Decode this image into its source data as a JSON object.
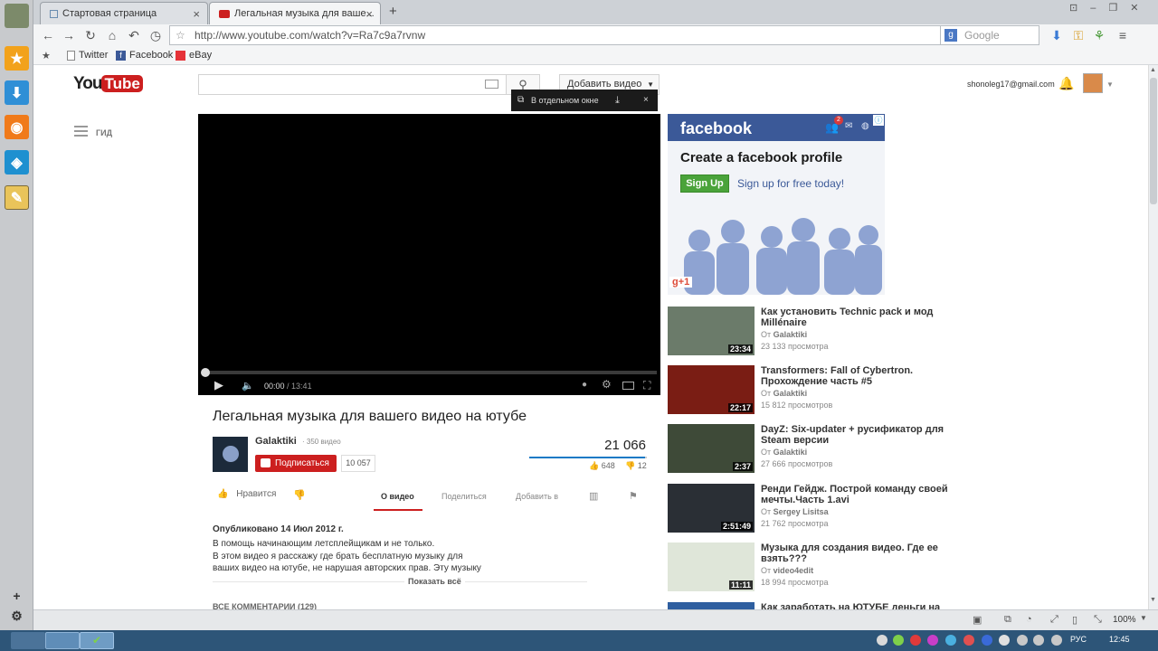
{
  "browser": {
    "tabs": [
      {
        "label": "Стартовая страница"
      },
      {
        "label": "Легальная музыка для ваше..."
      }
    ],
    "url": "http://www.youtube.com/watch?v=Ra7c9a7rvnw",
    "search_placeholder": "Google",
    "bookmarks": [
      "Twitter",
      "Facebook",
      "eBay"
    ],
    "zoom": "100%",
    "lang": "РУС",
    "clock": "12:45"
  },
  "youtube": {
    "logo": "YouTube",
    "upload_label": "Добавить видео",
    "popout_label": "В отдельном окне",
    "account": "shonoleg17@gmail.com",
    "guide_label": "ГИД",
    "player": {
      "time_current": "00:00",
      "time_total": "13:41",
      "progress": 0
    },
    "video": {
      "title": "Легальная музыка для вашего видео на ютубе",
      "channel": "Galaktiki",
      "channel_videos": "· 350 видео",
      "subscribe_label": "Подписаться",
      "subscribers": "10 057",
      "views": "21 066",
      "likes": "648",
      "dislikes": "12",
      "like_label": "Нравится"
    },
    "tabs": [
      "О видео",
      "Поделиться",
      "Добавить в"
    ],
    "description": {
      "published": "Опубликовано 14 Июл 2012 г.",
      "lines": [
        "В помощь начинающим летсплейщикам и не только.",
        "В этом видео я расскажу где брать бесплатную музыку для",
        "ваших видео на ютубе, не нарушая авторских прав. Эту музыку"
      ],
      "show_all": "Показать всё"
    },
    "comments_header": "ВСЕ КОММЕНТАРИИ (129)"
  },
  "ad": {
    "brand": "facebook",
    "headline": "Create a facebook profile",
    "signup_button": "Sign Up",
    "signup_text": "Sign up for free today!",
    "notif_count": "2",
    "gplus": "g+1"
  },
  "related": [
    {
      "title": "Как установить Technic pack и мод Millénaire",
      "channel": "Galaktiki",
      "views": "23 133 просмотра",
      "duration": "23:34",
      "thumb": "#6b7b6a"
    },
    {
      "title": "Transformers: Fall of Cybertron. Прохождение часть #5",
      "channel": "Galaktiki",
      "views": "15 812 просмотров",
      "duration": "22:17",
      "thumb": "#7a1d14"
    },
    {
      "title": "DayZ: Six-updater + русификатор для Steam версии",
      "channel": "Galaktiki",
      "views": "27 666 просмотров",
      "duration": "2:37",
      "thumb": "#3e4a38"
    },
    {
      "title": "Ренди Гейдж. Построй команду своей мечты.Часть 1.avi",
      "channel": "Sergey Lisitsa",
      "views": "21 762 просмотра",
      "duration": "2:51:49",
      "thumb": "#2a2f35"
    },
    {
      "title": "Музыка для создания видео. Где ее взять???",
      "channel": "video4edit",
      "views": "18 994 просмотра",
      "duration": "11:11",
      "thumb": "#dfe6d9"
    }
  ],
  "related_channel_prefix": "От ",
  "related_partial": "Как заработать на ЮТУБЕ деньги на"
}
